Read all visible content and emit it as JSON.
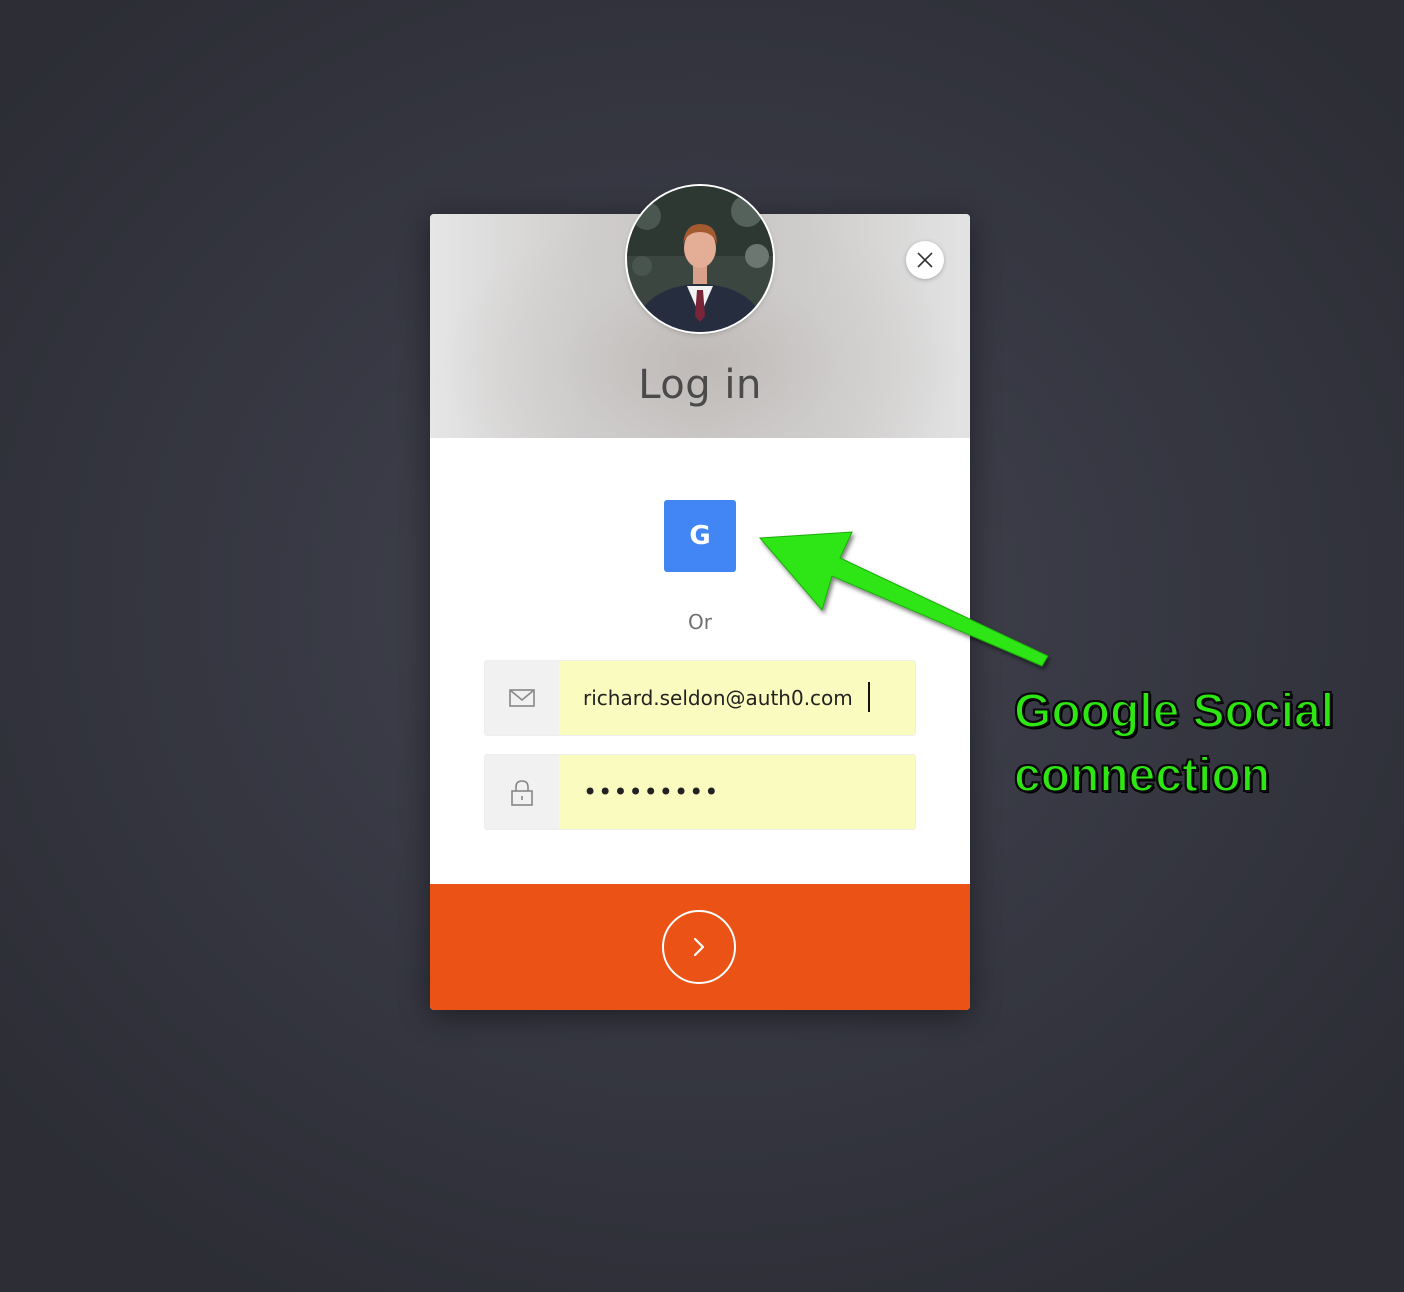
{
  "header": {
    "title": "Log in",
    "avatar_icon": "user-avatar-photo",
    "close_icon": "close-icon"
  },
  "social": {
    "google_label": "G",
    "google_color": "#4285f4"
  },
  "separator": {
    "label": "Or"
  },
  "email": {
    "value": "richard.seldon@auth0.com",
    "icon": "envelope-icon"
  },
  "password": {
    "masked_value": "•••••••••",
    "icon": "lock-icon"
  },
  "submit": {
    "icon": "chevron-right-icon",
    "color": "#ea5315"
  },
  "annotation": {
    "line1": "Google Social",
    "line2": "connection",
    "color": "#2ee612"
  }
}
